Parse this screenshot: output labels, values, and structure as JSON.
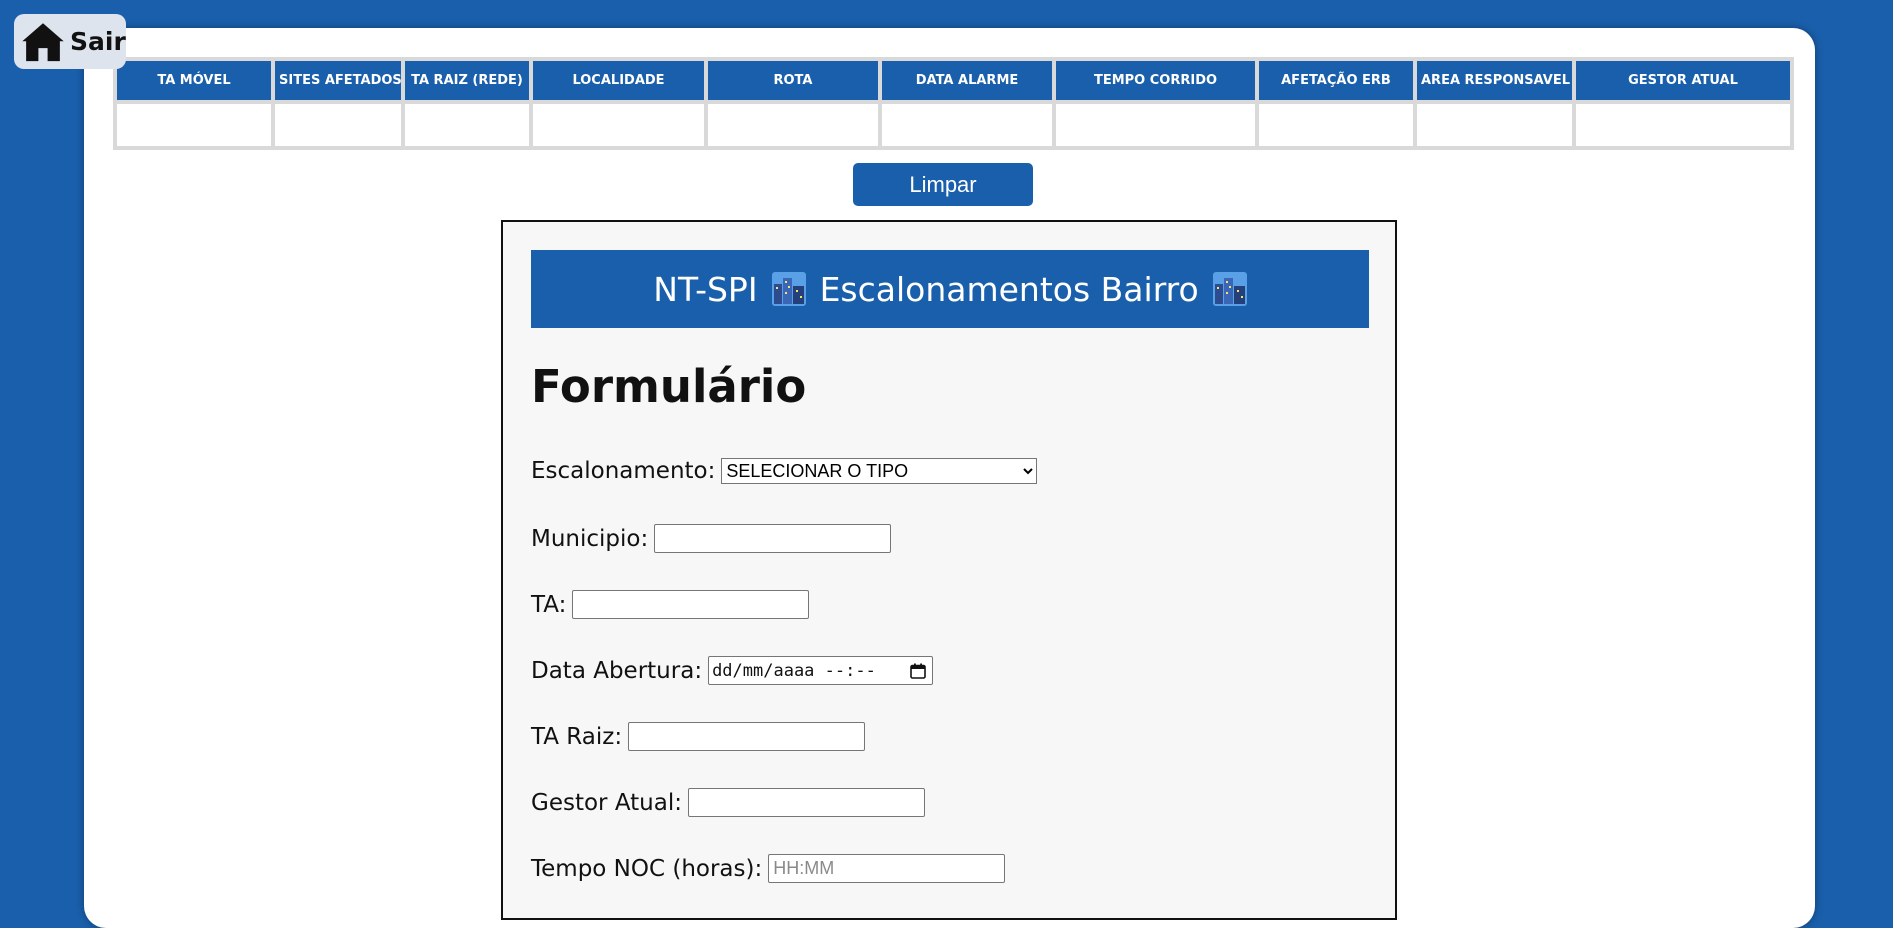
{
  "nav": {
    "home_label": "Sair"
  },
  "table": {
    "columns": [
      "TA MÓVEL",
      "SITES AFETADOS",
      "TA RAIZ (REDE)",
      "LOCALIDADE",
      "ROTA",
      "DATA ALARME",
      "TEMPO CORRIDO",
      "AFETAÇÃO ERB",
      "AREA RESPONSAVEL",
      "GESTOR ATUAL"
    ],
    "rows": [
      [
        "",
        "",
        "",
        "",
        "",
        "",
        "",
        "",
        "",
        ""
      ]
    ]
  },
  "actions": {
    "clear_label": "Limpar"
  },
  "form": {
    "header_title": "NT-SPI",
    "header_subtitle": "Escalonamentos Bairro",
    "header_icon": "cityscape-icon",
    "title": "Formulário",
    "escalonamento": {
      "label": "Escalonamento:",
      "selected": "SELECIONAR O TIPO"
    },
    "municipio": {
      "label": "Municipio:",
      "value": ""
    },
    "ta": {
      "label": "TA:",
      "value": ""
    },
    "data_abertura": {
      "label": "Data Abertura:",
      "value": "dd/mm/aaaa --:--"
    },
    "ta_raiz": {
      "label": "TA Raiz:",
      "value": ""
    },
    "gestor_atual": {
      "label": "Gestor Atual:",
      "value": ""
    },
    "tempo_noc": {
      "label": "Tempo NOC (horas):",
      "placeholder": "HH:MM",
      "value": ""
    }
  },
  "colors": {
    "brand_blue": "#1a5fab",
    "table_border": "#d9d9d9",
    "form_bg": "#f7f7f7"
  }
}
